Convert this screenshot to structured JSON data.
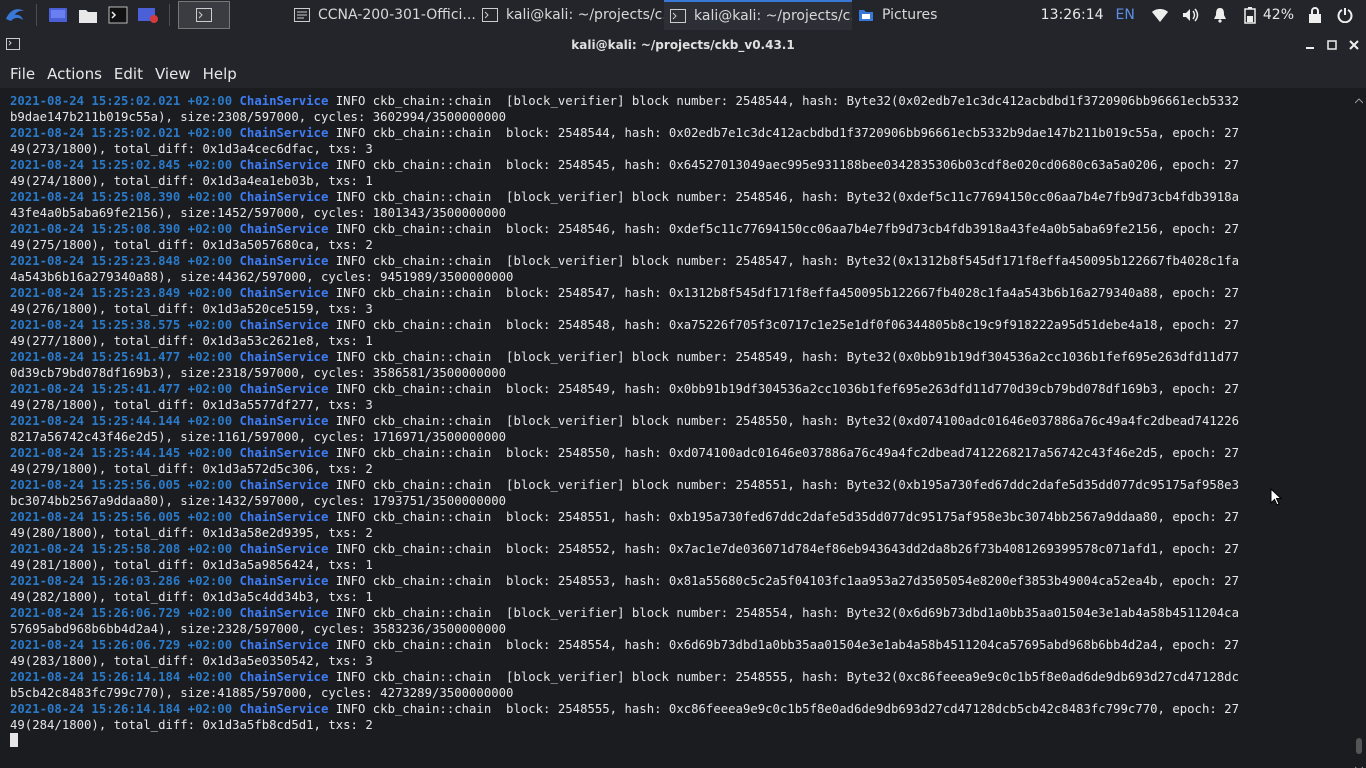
{
  "panel": {
    "tasks": [
      {
        "label": "CCNA-200-301-Offici...",
        "icon": "browser-icon",
        "active": false
      },
      {
        "label": "kali@kali: ~/projects/c...",
        "icon": "terminal-icon",
        "active": false
      },
      {
        "label": "kali@kali: ~/projects/c...",
        "icon": "terminal-icon",
        "active": true
      },
      {
        "label": "Pictures",
        "icon": "folder-icon",
        "active": false
      }
    ],
    "clock": "13:26:14",
    "language": "EN",
    "battery": "42%"
  },
  "window": {
    "title": "kali@kali: ~/projects/ckb_v0.43.1",
    "menu": [
      "File",
      "Actions",
      "Edit",
      "View",
      "Help"
    ]
  },
  "colors": {
    "timestamp": "#2a7ac9",
    "service": "#3e7cf5",
    "accent": "#3a78d8"
  },
  "terminal": {
    "lines": [
      {
        "ts": "2021-08-24 15:25:02.021 +02:00",
        "svc": "ChainService",
        "rest": " INFO ckb_chain::chain  [block_verifier] block number: 2548544, hash: Byte32(0x02edb7e1c3dc412acbdbd1f3720906bb96661ecb5332"
      },
      {
        "text": "b9dae147b211b019c55a), size:2308/597000, cycles: 3602994/3500000000"
      },
      {
        "ts": "2021-08-24 15:25:02.021 +02:00",
        "svc": "ChainService",
        "rest": " INFO ckb_chain::chain  block: 2548544, hash: 0x02edb7e1c3dc412acbdbd1f3720906bb96661ecb5332b9dae147b211b019c55a, epoch: 27"
      },
      {
        "text": "49(273/1800), total_diff: 0x1d3a4cec6dfac, txs: 3"
      },
      {
        "ts": "2021-08-24 15:25:02.845 +02:00",
        "svc": "ChainService",
        "rest": " INFO ckb_chain::chain  block: 2548545, hash: 0x64527013049aec995e931188bee0342835306b03cdf8e020cd0680c63a5a0206, epoch: 27"
      },
      {
        "text": "49(274/1800), total_diff: 0x1d3a4ea1eb03b, txs: 1"
      },
      {
        "ts": "2021-08-24 15:25:08.390 +02:00",
        "svc": "ChainService",
        "rest": " INFO ckb_chain::chain  [block_verifier] block number: 2548546, hash: Byte32(0xdef5c11c77694150cc06aa7b4e7fb9d73cb4fdb3918a"
      },
      {
        "text": "43fe4a0b5aba69fe2156), size:1452/597000, cycles: 1801343/3500000000"
      },
      {
        "ts": "2021-08-24 15:25:08.390 +02:00",
        "svc": "ChainService",
        "rest": " INFO ckb_chain::chain  block: 2548546, hash: 0xdef5c11c77694150cc06aa7b4e7fb9d73cb4fdb3918a43fe4a0b5aba69fe2156, epoch: 27"
      },
      {
        "text": "49(275/1800), total_diff: 0x1d3a5057680ca, txs: 2"
      },
      {
        "ts": "2021-08-24 15:25:23.848 +02:00",
        "svc": "ChainService",
        "rest": " INFO ckb_chain::chain  [block_verifier] block number: 2548547, hash: Byte32(0x1312b8f545df171f8effa450095b122667fb4028c1fa"
      },
      {
        "text": "4a543b6b16a279340a88), size:44362/597000, cycles: 9451989/3500000000"
      },
      {
        "ts": "2021-08-24 15:25:23.849 +02:00",
        "svc": "ChainService",
        "rest": " INFO ckb_chain::chain  block: 2548547, hash: 0x1312b8f545df171f8effa450095b122667fb4028c1fa4a543b6b16a279340a88, epoch: 27"
      },
      {
        "text": "49(276/1800), total_diff: 0x1d3a520ce5159, txs: 3"
      },
      {
        "ts": "2021-08-24 15:25:38.575 +02:00",
        "svc": "ChainService",
        "rest": " INFO ckb_chain::chain  block: 2548548, hash: 0xa75226f705f3c0717c1e25e1df0f06344805b8c19c9f918222a95d51debe4a18, epoch: 27"
      },
      {
        "text": "49(277/1800), total_diff: 0x1d3a53c2621e8, txs: 1"
      },
      {
        "ts": "2021-08-24 15:25:41.477 +02:00",
        "svc": "ChainService",
        "rest": " INFO ckb_chain::chain  [block_verifier] block number: 2548549, hash: Byte32(0x0bb91b19df304536a2cc1036b1fef695e263dfd11d77"
      },
      {
        "text": "0d39cb79bd078df169b3), size:2318/597000, cycles: 3586581/3500000000"
      },
      {
        "ts": "2021-08-24 15:25:41.477 +02:00",
        "svc": "ChainService",
        "rest": " INFO ckb_chain::chain  block: 2548549, hash: 0x0bb91b19df304536a2cc1036b1fef695e263dfd11d770d39cb79bd078df169b3, epoch: 27"
      },
      {
        "text": "49(278/1800), total_diff: 0x1d3a5577df277, txs: 3"
      },
      {
        "ts": "2021-08-24 15:25:44.144 +02:00",
        "svc": "ChainService",
        "rest": " INFO ckb_chain::chain  [block_verifier] block number: 2548550, hash: Byte32(0xd074100adc01646e037886a76c49a4fc2dbead741226"
      },
      {
        "text": "8217a56742c43f46e2d5), size:1161/597000, cycles: 1716971/3500000000"
      },
      {
        "ts": "2021-08-24 15:25:44.145 +02:00",
        "svc": "ChainService",
        "rest": " INFO ckb_chain::chain  block: 2548550, hash: 0xd074100adc01646e037886a76c49a4fc2dbead7412268217a56742c43f46e2d5, epoch: 27"
      },
      {
        "text": "49(279/1800), total_diff: 0x1d3a572d5c306, txs: 2"
      },
      {
        "ts": "2021-08-24 15:25:56.005 +02:00",
        "svc": "ChainService",
        "rest": " INFO ckb_chain::chain  [block_verifier] block number: 2548551, hash: Byte32(0xb195a730fed67ddc2dafe5d35dd077dc95175af958e3"
      },
      {
        "text": "bc3074bb2567a9ddaa80), size:1432/597000, cycles: 1793751/3500000000"
      },
      {
        "ts": "2021-08-24 15:25:56.005 +02:00",
        "svc": "ChainService",
        "rest": " INFO ckb_chain::chain  block: 2548551, hash: 0xb195a730fed67ddc2dafe5d35dd077dc95175af958e3bc3074bb2567a9ddaa80, epoch: 27"
      },
      {
        "text": "49(280/1800), total_diff: 0x1d3a58e2d9395, txs: 2"
      },
      {
        "ts": "2021-08-24 15:25:58.208 +02:00",
        "svc": "ChainService",
        "rest": " INFO ckb_chain::chain  block: 2548552, hash: 0x7ac1e7de036071d784ef86eb943643dd2da8b26f73b4081269399578c071afd1, epoch: 27"
      },
      {
        "text": "49(281/1800), total_diff: 0x1d3a5a9856424, txs: 1"
      },
      {
        "ts": "2021-08-24 15:26:03.286 +02:00",
        "svc": "ChainService",
        "rest": " INFO ckb_chain::chain  block: 2548553, hash: 0x81a55680c5c2a5f04103fc1aa953a27d3505054e8200ef3853b49004ca52ea4b, epoch: 27"
      },
      {
        "text": "49(282/1800), total_diff: 0x1d3a5c4dd34b3, txs: 1"
      },
      {
        "ts": "2021-08-24 15:26:06.729 +02:00",
        "svc": "ChainService",
        "rest": " INFO ckb_chain::chain  [block_verifier] block number: 2548554, hash: Byte32(0x6d69b73dbd1a0bb35aa01504e3e1ab4a58b4511204ca"
      },
      {
        "text": "57695abd968b6bb4d2a4), size:2328/597000, cycles: 3583236/3500000000"
      },
      {
        "ts": "2021-08-24 15:26:06.729 +02:00",
        "svc": "ChainService",
        "rest": " INFO ckb_chain::chain  block: 2548554, hash: 0x6d69b73dbd1a0bb35aa01504e3e1ab4a58b4511204ca57695abd968b6bb4d2a4, epoch: 27"
      },
      {
        "text": "49(283/1800), total_diff: 0x1d3a5e0350542, txs: 3"
      },
      {
        "ts": "2021-08-24 15:26:14.184 +02:00",
        "svc": "ChainService",
        "rest": " INFO ckb_chain::chain  [block_verifier] block number: 2548555, hash: Byte32(0xc86feeea9e9c0c1b5f8e0ad6de9db693d27cd47128dc"
      },
      {
        "text": "b5cb42c8483fc799c770), size:41885/597000, cycles: 4273289/3500000000"
      },
      {
        "ts": "2021-08-24 15:26:14.184 +02:00",
        "svc": "ChainService",
        "rest": " INFO ckb_chain::chain  block: 2548555, hash: 0xc86feeea9e9c0c1b5f8e0ad6de9db693d27cd47128dcb5cb42c8483fc799c770, epoch: 27"
      },
      {
        "text": "49(284/1800), total_diff: 0x1d3a5fb8cd5d1, txs: 2"
      }
    ]
  }
}
